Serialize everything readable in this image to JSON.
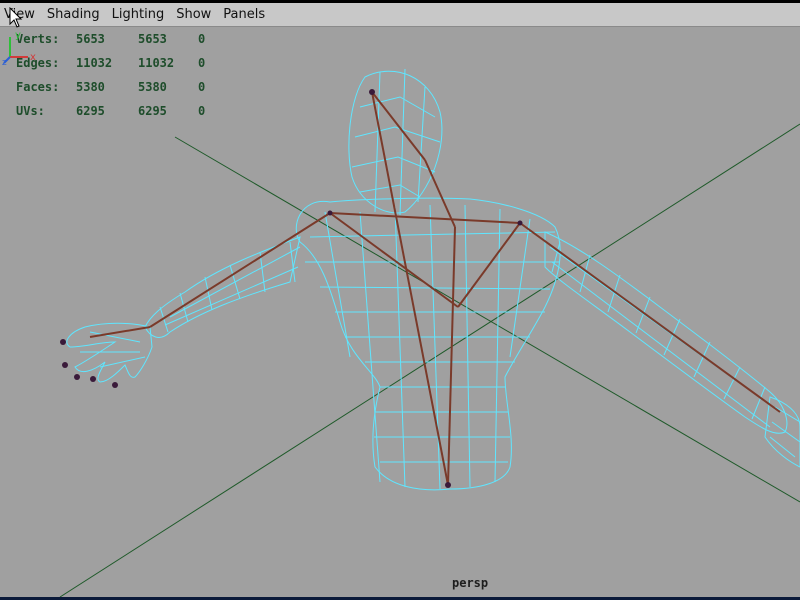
{
  "menubar": {
    "items": [
      {
        "label": "View"
      },
      {
        "label": "Shading"
      },
      {
        "label": "Lighting"
      },
      {
        "label": "Show"
      },
      {
        "label": "Panels"
      }
    ]
  },
  "stats": {
    "rows": [
      {
        "label": "Verts:",
        "v1": "5653",
        "v2": "5653",
        "v3": "0"
      },
      {
        "label": "Edges:",
        "v1": "11032",
        "v2": "11032",
        "v3": "0"
      },
      {
        "label": "Faces:",
        "v1": "5380",
        "v2": "5380",
        "v3": "0"
      },
      {
        "label": "UVs:",
        "v1": "6295",
        "v2": "6295",
        "v3": "0"
      }
    ]
  },
  "viewport": {
    "camera_label": "persp",
    "background_color": "#a0a0a0",
    "grid_color": "#1f5a2a",
    "wireframe_color": "#5fe6ff",
    "skeleton_color": "#7a3a2a"
  },
  "axis_indicator": {
    "y": "y",
    "x": "x",
    "z": "z"
  },
  "icons": {
    "cursor": "mouse-pointer-icon",
    "axis": "axis-gizmo-icon"
  }
}
